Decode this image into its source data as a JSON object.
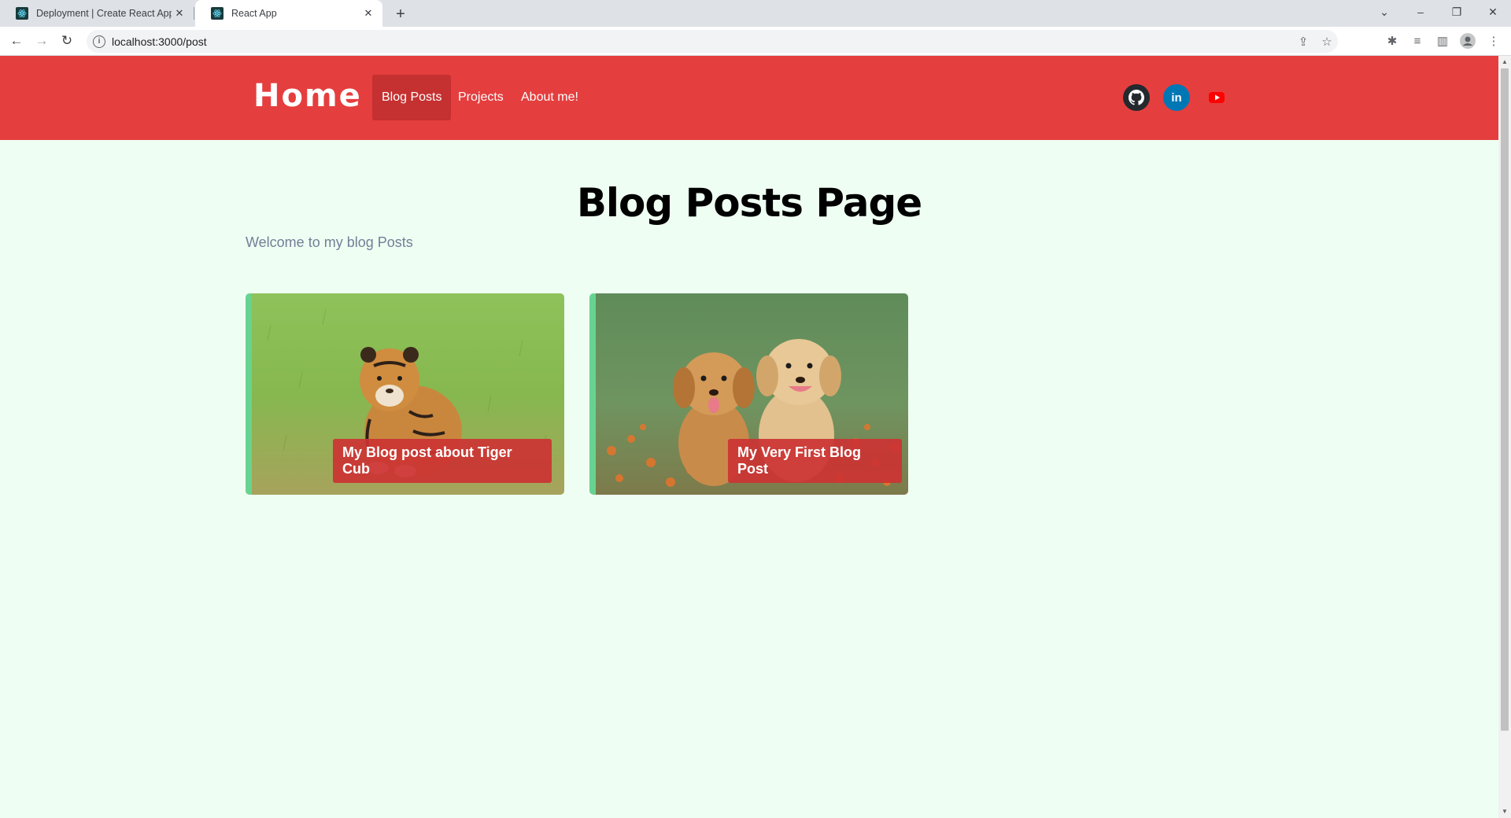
{
  "browser": {
    "tabs": [
      {
        "title": "Deployment | Create React App",
        "active": false
      },
      {
        "title": "React App",
        "active": true
      }
    ],
    "new_tab_icon": "plus-icon",
    "url": "localhost:3000/post",
    "window_controls": [
      "chevron-down-icon",
      "minimize-icon",
      "restore-icon",
      "close-icon"
    ],
    "toolbar_icons": [
      "share-icon",
      "star-icon",
      "extensions-icon",
      "media-icon",
      "side-panel-icon",
      "profile-icon",
      "menu-icon"
    ]
  },
  "site": {
    "brand": "Home",
    "nav": [
      {
        "label": "Blog Posts",
        "active": true
      },
      {
        "label": "Projects",
        "active": false
      },
      {
        "label": "About me!",
        "active": false
      }
    ],
    "social": [
      {
        "name": "github-icon",
        "glyph": "⌥",
        "color": "#24292e"
      },
      {
        "name": "linkedin-icon",
        "glyph": "in",
        "color": "#0077b5"
      },
      {
        "name": "youtube-icon",
        "glyph": "▶",
        "color": "#ff0000"
      }
    ],
    "header_color": "#e53e3e",
    "background_color": "#effef3"
  },
  "main": {
    "title": "Blog Posts Page",
    "subtitle": "Welcome to my blog Posts",
    "posts": [
      {
        "title": "My Blog post about Tiger Cub",
        "image": "tiger-cub-image"
      },
      {
        "title": "My Very First Blog Post",
        "image": "puppies-image"
      }
    ]
  }
}
